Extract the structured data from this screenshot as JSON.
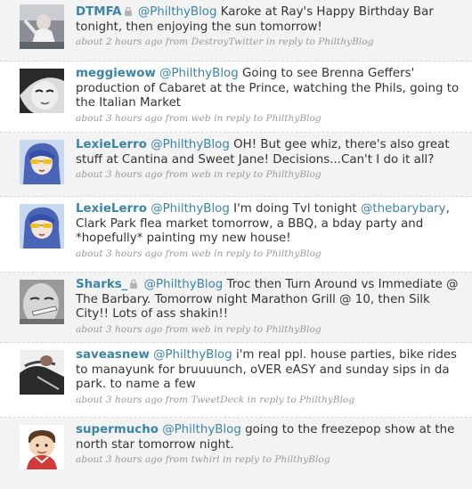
{
  "tweets": [
    {
      "username": "DTMFA",
      "protected": true,
      "mention": "@PhilthyBlog",
      "text": " Karoke at Ray's Happy Birthday Bar tonight, then enjoying the sun tomorrow!",
      "time": "about 2 hours ago",
      "from_label": "from",
      "source": "DestroyTwitter",
      "reply_label": "in reply to",
      "reply_to": "PhilthyBlog",
      "avatar": "dtmfa-avatar"
    },
    {
      "username": "meggiewow",
      "protected": false,
      "mention": "@PhilthyBlog",
      "text": " Going to see Brenna Geffers' production of Cabaret at the Prince, watching the Phils, going to the Italian Market",
      "time": "about 3 hours ago",
      "from_label": "from",
      "source": "web",
      "reply_label": "in reply to",
      "reply_to": "PhilthyBlog",
      "avatar": "meggiewow-avatar"
    },
    {
      "username": "LexieLerro",
      "protected": false,
      "mention": "@PhilthyBlog",
      "text": " OH! But gee whiz, there's also great stuff at Cantina and Sweet Jane! Decisions...Can't I do it all?",
      "time": "about 3 hours ago",
      "from_label": "from",
      "source": "web",
      "reply_label": "in reply to",
      "reply_to": "PhilthyBlog",
      "avatar": "lexielerro-avatar"
    },
    {
      "username": "LexieLerro",
      "protected": false,
      "mention": "@PhilthyBlog",
      "text_before": " I'm doing Tvl tonight ",
      "mention2": "@thebarybary",
      "text": ", Clark Park flea market tomorrow, a BBQ, a bday party and *hopefully* painting my new house!",
      "time": "about 3 hours ago",
      "from_label": "from",
      "source": "web",
      "reply_label": "in reply to",
      "reply_to": "PhilthyBlog",
      "avatar": "lexielerro-avatar"
    },
    {
      "username": "Sharks_",
      "protected": true,
      "mention": "@PhilthyBlog",
      "text": " Troc then Turn Around vs Immediate @ The Barbary. Tomorrow night Marathon Grill @ 10, then Silk City!! Lots of ass shakin!!",
      "time": "about 3 hours ago",
      "from_label": "from",
      "source": "web",
      "reply_label": "in reply to",
      "reply_to": "PhilthyBlog",
      "avatar": "sharks-avatar"
    },
    {
      "username": "saveasnew",
      "protected": false,
      "mention": "@PhilthyBlog",
      "text": " i'm real ppl. house parties, bike rides to manayunk for bruuuunch, oVER eASY and sunday sips in da park. to name a few",
      "time": "about 3 hours ago",
      "from_label": "from",
      "source": "TweetDeck",
      "reply_label": "in reply to",
      "reply_to": "PhilthyBlog",
      "avatar": "saveasnew-avatar"
    },
    {
      "username": "supermucho",
      "protected": false,
      "mention": "@PhilthyBlog",
      "text": " going to the freezepop show at the north star tomorrow night.",
      "time": "about 3 hours ago",
      "from_label": "from",
      "source": "twhirl",
      "reply_label": "in reply to",
      "reply_to": "PhilthyBlog",
      "avatar": "supermucho-avatar"
    }
  ],
  "colors": {
    "link": "#3a84a8",
    "text": "#333333",
    "meta": "#999999",
    "shaded_row": "#f3f3f3",
    "divider": "#d2dada"
  }
}
